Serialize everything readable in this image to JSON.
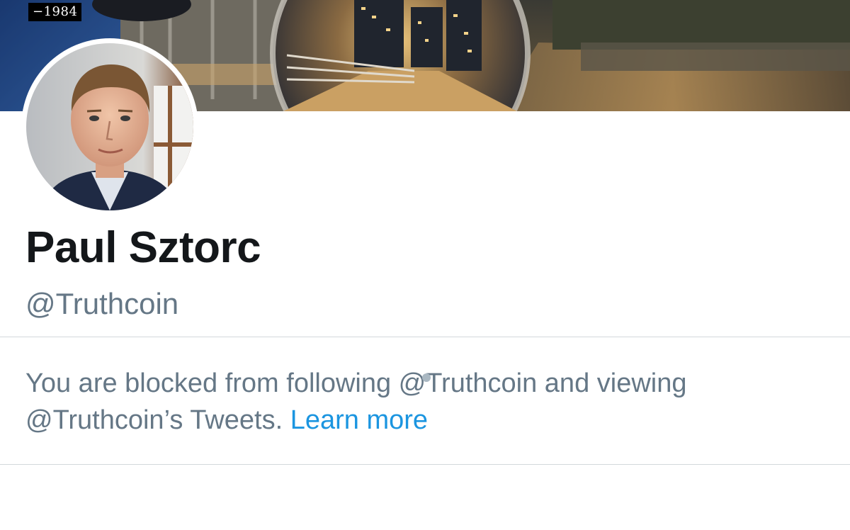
{
  "header": {
    "banner_caption": "−1984"
  },
  "profile": {
    "display_name": "Paul Sztorc",
    "handle": "@Truthcoin"
  },
  "notice": {
    "text": "You are blocked from following @Truthcoin and viewing @Truthcoin’s Tweets.",
    "learn_more_label": "Learn more"
  },
  "colors": {
    "name_text": "#14171a",
    "secondary_text": "#657786",
    "link": "#1b95e0",
    "divider": "#d3d8dc"
  }
}
